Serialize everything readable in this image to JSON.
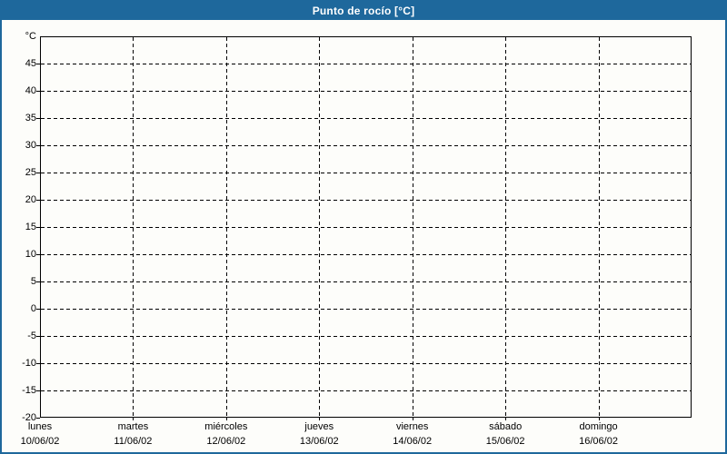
{
  "window": {
    "title": "Punto de rocío [°C]"
  },
  "colors": {
    "titlebar_bg": "#1E689C",
    "window_border": "#1E689C",
    "titlebar_text": "#FFFFFF",
    "content_bg": "#FDFDFA",
    "grid_color": "#000000",
    "axis_color": "#000000",
    "label_color": "#000000"
  },
  "chart_data": {
    "type": "line",
    "title": "Punto de rocío [°C]",
    "ylabel": "°C",
    "ylim": [
      -20,
      50
    ],
    "y_tick_step": 5,
    "y_tick_labels": [
      45,
      40,
      35,
      30,
      25,
      20,
      15,
      10,
      5,
      0,
      -5,
      -10,
      -15,
      -20
    ],
    "x_day_labels": [
      "lunes",
      "martes",
      "miércoles",
      "jueves",
      "viernes",
      "sábado",
      "domingo"
    ],
    "x_date_labels": [
      "10/06/02",
      "11/06/02",
      "12/06/02",
      "13/06/02",
      "14/06/02",
      "15/06/02",
      "16/06/02"
    ],
    "x_divisions": 7,
    "grid": "dashed",
    "legend": "none",
    "series": []
  }
}
